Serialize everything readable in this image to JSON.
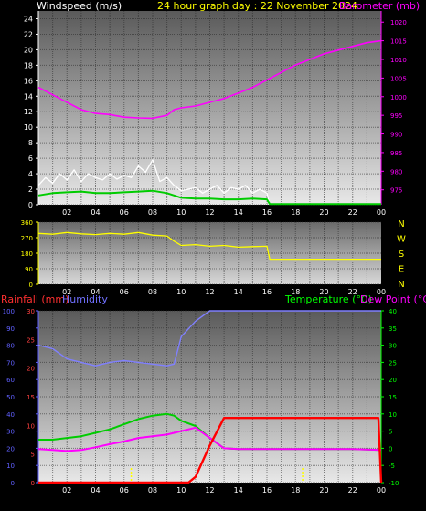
{
  "header": {
    "windspeed_label": "Windspeed (m/s)",
    "title": "24 hour graph day : 22 November 2024",
    "barometer_label": "Barometer (mb)"
  },
  "lower_header": {
    "rainfall_label": "Rainfall (mm)",
    "humidity_label": "Humidity",
    "temperature_label": "Temperature (°C)",
    "dewpoint_label": "Dew Point (°C)"
  },
  "colors": {
    "wind": "#ffffff",
    "wind_avg": "#00cc00",
    "barometer": "#ff00ff",
    "direction": "#ffff00",
    "rainfall": "#ff0000",
    "humidity": "#8080ff",
    "temperature": "#00cc00",
    "dewpoint": "#ff00ff",
    "left_axis": "#ffffff",
    "rain_axis": "#ff4040",
    "humidity_axis": "#6060ff",
    "temp_axis": "#00ff00"
  },
  "chart_data": [
    {
      "type": "line",
      "panel": "wind_barometer",
      "x_tick_labels": [
        "02",
        "04",
        "06",
        "08",
        "10",
        "12",
        "14",
        "16",
        "18",
        "20",
        "22",
        "00"
      ],
      "left_axis": {
        "label": "Windspeed (m/s)",
        "ylim": [
          0,
          25
        ],
        "ticks": [
          0,
          2,
          4,
          6,
          8,
          10,
          12,
          14,
          16,
          18,
          20,
          22,
          24
        ]
      },
      "right_axis": {
        "label": "Barometer (mb)",
        "ylim": [
          971,
          1023
        ],
        "ticks": [
          975,
          980,
          985,
          990,
          995,
          1000,
          1005,
          1010,
          1015,
          1020
        ]
      },
      "series": [
        {
          "name": "Barometer (mb)",
          "axis": "right",
          "x": [
            0,
            1,
            2,
            3,
            4,
            5,
            6,
            7,
            8,
            9,
            9.5,
            10,
            11,
            12,
            13,
            14,
            15,
            16,
            17,
            18,
            19,
            20,
            21,
            22,
            23,
            24
          ],
          "values": [
            1002.5,
            1000.5,
            998.5,
            996.5,
            995.5,
            995.2,
            994.5,
            994.3,
            994.2,
            995,
            996.5,
            997,
            997.5,
            998.5,
            999.5,
            1001,
            1002.5,
            1004.5,
            1006.5,
            1008.5,
            1010,
            1011.5,
            1012.5,
            1013.5,
            1014.5,
            1015
          ]
        },
        {
          "name": "Windspeed (m/s)",
          "axis": "left",
          "x": [
            0,
            0.5,
            1,
            1.5,
            2,
            2.5,
            3,
            3.5,
            4,
            4.5,
            5,
            5.5,
            6,
            6.5,
            7,
            7.5,
            8,
            8.5,
            9,
            9.5,
            10,
            10.5,
            11,
            11.5,
            12,
            12.5,
            13,
            13.5,
            14,
            14.5,
            15,
            15.5,
            16,
            16.2
          ],
          "values": [
            2.5,
            3.5,
            2.8,
            4,
            3.2,
            4.5,
            3,
            4,
            3.5,
            3.2,
            4,
            3.3,
            3.8,
            3.5,
            5,
            4.2,
            5.8,
            3,
            3.5,
            2.5,
            1.8,
            2,
            2.2,
            1.5,
            2,
            2.5,
            1.5,
            2.2,
            2,
            2.5,
            1.5,
            2,
            1.5,
            0
          ]
        },
        {
          "name": "Average windspeed",
          "axis": "left",
          "x": [
            0,
            1,
            2,
            3,
            4,
            5,
            6,
            7,
            8,
            9,
            9.5,
            10,
            11,
            12,
            13,
            14,
            15,
            16,
            16.2,
            24
          ],
          "values": [
            1.2,
            1.5,
            1.6,
            1.7,
            1.5,
            1.5,
            1.6,
            1.7,
            1.8,
            1.5,
            1.2,
            0.9,
            0.8,
            0.8,
            0.7,
            0.7,
            0.8,
            0.7,
            0.1,
            0.1
          ]
        }
      ]
    },
    {
      "type": "line",
      "panel": "wind_direction",
      "x_tick_labels": [
        "02",
        "04",
        "06",
        "08",
        "10",
        "12",
        "14",
        "16",
        "18",
        "20",
        "22",
        "00"
      ],
      "left_axis": {
        "ylim": [
          0,
          360
        ],
        "ticks": [
          0,
          90,
          180,
          270,
          360
        ]
      },
      "right_axis_labels": [
        "N",
        "W",
        "S",
        "E",
        "N"
      ],
      "series": [
        {
          "name": "Wind direction",
          "axis": "left",
          "x": [
            0,
            1,
            2,
            3,
            4,
            5,
            6,
            7,
            8,
            9,
            9.5,
            10,
            11,
            12,
            13,
            14,
            15,
            16,
            16.2,
            17,
            18,
            19,
            20,
            21,
            22,
            23,
            24
          ],
          "values": [
            295,
            290,
            300,
            292,
            288,
            295,
            290,
            300,
            285,
            280,
            250,
            225,
            230,
            220,
            225,
            215,
            218,
            220,
            145,
            145,
            145,
            145,
            145,
            145,
            145,
            145,
            145
          ]
        }
      ]
    },
    {
      "type": "line",
      "panel": "rain_humidity_temperature",
      "x_tick_labels": [
        "02",
        "04",
        "06",
        "08",
        "10",
        "12",
        "14",
        "16",
        "18",
        "20",
        "22",
        "00"
      ],
      "humidity_axis": {
        "label": "Humidity",
        "ylim": [
          0,
          100
        ],
        "ticks": [
          0,
          10,
          20,
          30,
          40,
          50,
          60,
          70,
          80,
          90,
          100
        ]
      },
      "rain_axis": {
        "label": "Rainfall (mm)",
        "ylim": [
          0,
          30
        ],
        "ticks": [
          0,
          5,
          10,
          15,
          20,
          25,
          30
        ]
      },
      "temp_axis": {
        "label": "Temperature (°C)",
        "ylim": [
          -10,
          40
        ],
        "ticks": [
          -10,
          -5,
          0,
          5,
          10,
          15,
          20,
          25,
          30,
          35,
          40
        ]
      },
      "series": [
        {
          "name": "Humidity",
          "axis": "humidity",
          "x": [
            0,
            1,
            2,
            3,
            4,
            5,
            6,
            7,
            8,
            9,
            9.5,
            10,
            11,
            12,
            13,
            24
          ],
          "values": [
            80,
            78,
            72,
            70,
            68,
            70,
            71,
            70,
            69,
            68,
            69,
            85,
            94,
            100,
            100,
            100
          ]
        },
        {
          "name": "Rainfall (mm)",
          "axis": "rain",
          "x": [
            0,
            1,
            2,
            3,
            4,
            5,
            6,
            7,
            8,
            9,
            10,
            10.5,
            11,
            12,
            13,
            14,
            16,
            18,
            20,
            22,
            23.8,
            24
          ],
          "values": [
            0,
            0,
            0,
            0,
            0,
            0,
            0,
            0,
            0,
            0,
            0,
            0,
            1,
            6.5,
            11.3,
            11.3,
            11.3,
            11.3,
            11.3,
            11.3,
            11.3,
            0
          ]
        },
        {
          "name": "Temperature (°C)",
          "axis": "temp",
          "x": [
            0,
            1,
            2,
            3,
            4,
            5,
            6,
            7,
            8,
            9,
            9.5,
            10,
            11,
            12,
            13,
            14,
            16,
            18,
            20,
            22,
            24
          ],
          "values": [
            2.5,
            2.5,
            3,
            3.5,
            4.5,
            5.5,
            7,
            8.5,
            9.5,
            10,
            9.5,
            8,
            6.5,
            3,
            0,
            -0.2,
            -0.2,
            -0.2,
            -0.2,
            -0.2,
            -0.5
          ]
        },
        {
          "name": "Dew Point (°C)",
          "axis": "temp",
          "x": [
            0,
            1,
            2,
            3,
            4,
            5,
            6,
            7,
            8,
            9,
            10,
            11,
            12,
            13,
            14,
            16,
            18,
            20,
            22,
            24
          ],
          "values": [
            -0.2,
            -0.5,
            -0.8,
            -0.5,
            0.3,
            1.2,
            2,
            3,
            3.5,
            4,
            5,
            6,
            3,
            0,
            -0.2,
            -0.2,
            -0.2,
            -0.2,
            -0.2,
            -0.5
          ]
        }
      ]
    }
  ]
}
